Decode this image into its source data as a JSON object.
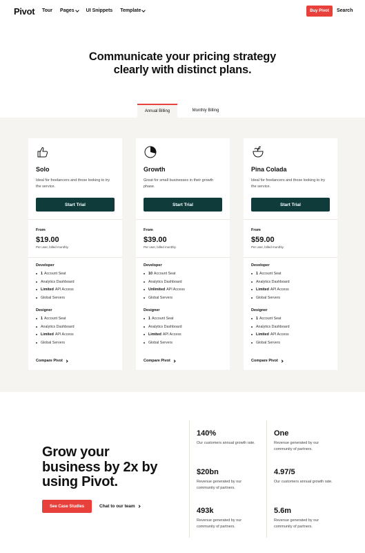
{
  "nav": {
    "logo": "Pivot",
    "links": [
      "Tour",
      "Pages",
      "UI Snippets",
      "Template"
    ],
    "buy_label": "Buy Pivot",
    "search_label": "Search"
  },
  "hero": {
    "title_line1": "Communicate your pricing strategy",
    "title_line2": "clearly with distinct plans."
  },
  "billing_tabs": {
    "annual": "Annual Billing",
    "monthly": "Monthly Billing",
    "active": "annual"
  },
  "plans": [
    {
      "icon": "thumbs-up-icon",
      "name": "Solo",
      "description": "Ideal for freelancers and those looking to try the service.",
      "button": "Start Trial",
      "from_label": "From",
      "price": "$19.00",
      "price_note": "Per user, billed monthly.",
      "developer_title": "Developer",
      "developer": [
        {
          "bold": "1",
          "text": "Account Seat"
        },
        {
          "bold": "",
          "text": "Analytics Dashboard"
        },
        {
          "bold": "Limited",
          "text": "API Access"
        },
        {
          "bold": "",
          "text": "Global Servers"
        }
      ],
      "designer_title": "Designer",
      "designer": [
        {
          "bold": "1",
          "text": "Account Seat"
        },
        {
          "bold": "",
          "text": "Analytics Dashboard"
        },
        {
          "bold": "Limited",
          "text": "API Access"
        },
        {
          "bold": "",
          "text": "Global Servers"
        }
      ],
      "compare": "Compare Pivot"
    },
    {
      "icon": "pie-chart-icon",
      "name": "Growth",
      "description": "Great for small businesses in their growth phase.",
      "button": "Start Trial",
      "from_label": "From",
      "price": "$39.00",
      "price_note": "Per user, billed monthly.",
      "developer_title": "Developer",
      "developer": [
        {
          "bold": "10",
          "text": "Account Seat"
        },
        {
          "bold": "",
          "text": "Analytics Dashboard"
        },
        {
          "bold": "Unlimited",
          "text": "API Access"
        },
        {
          "bold": "",
          "text": "Global Servers"
        }
      ],
      "designer_title": "Designer",
      "designer": [
        {
          "bold": "1",
          "text": "Account Seat"
        },
        {
          "bold": "",
          "text": "Analytics Dashboard"
        },
        {
          "bold": "Limited",
          "text": "API Access"
        },
        {
          "bold": "",
          "text": "Global Servers"
        }
      ],
      "compare": "Compare Pivot"
    },
    {
      "icon": "coconut-drink-icon",
      "name": "Pina Colada",
      "description": "Ideal for freelancers and those looking to try the service.",
      "button": "Start Trial",
      "from_label": "From",
      "price": "$59.00",
      "price_note": "Per user, billed monthly.",
      "developer_title": "Developer",
      "developer": [
        {
          "bold": "1",
          "text": "Account Seat"
        },
        {
          "bold": "",
          "text": "Analytics Dashboard"
        },
        {
          "bold": "Limited",
          "text": "API Access"
        },
        {
          "bold": "",
          "text": "Global Servers"
        }
      ],
      "designer_title": "Designer",
      "designer": [
        {
          "bold": "1",
          "text": "Account Seat"
        },
        {
          "bold": "",
          "text": "Analytics Dashboard"
        },
        {
          "bold": "Limited",
          "text": "API Access"
        },
        {
          "bold": "",
          "text": "Global Servers"
        }
      ],
      "compare": "Compare Pivot"
    }
  ],
  "grow": {
    "title_line1": "Grow your",
    "title_line2": "business by 2x by",
    "title_line3": "using Pivot.",
    "case_button": "See Case Studies",
    "chat_link": "Chat to our team"
  },
  "stats": [
    {
      "value": "140%",
      "text": "Our customers annual growth rate."
    },
    {
      "value": "One",
      "text": "Revenue generated by our community of partners."
    },
    {
      "value": "$20bn",
      "text": "Revenue generated by our community of partners."
    },
    {
      "value": "4.97/5",
      "text": "Our customers annual growth rate."
    },
    {
      "value": "493k",
      "text": "Revenue generated by our community of partners."
    },
    {
      "value": "5.6m",
      "text": "Revenue generated by our community of partners."
    }
  ],
  "colors": {
    "accent": "#e8403a",
    "button_dark": "#0f3b3b",
    "section_bg": "#f5f4f1"
  }
}
